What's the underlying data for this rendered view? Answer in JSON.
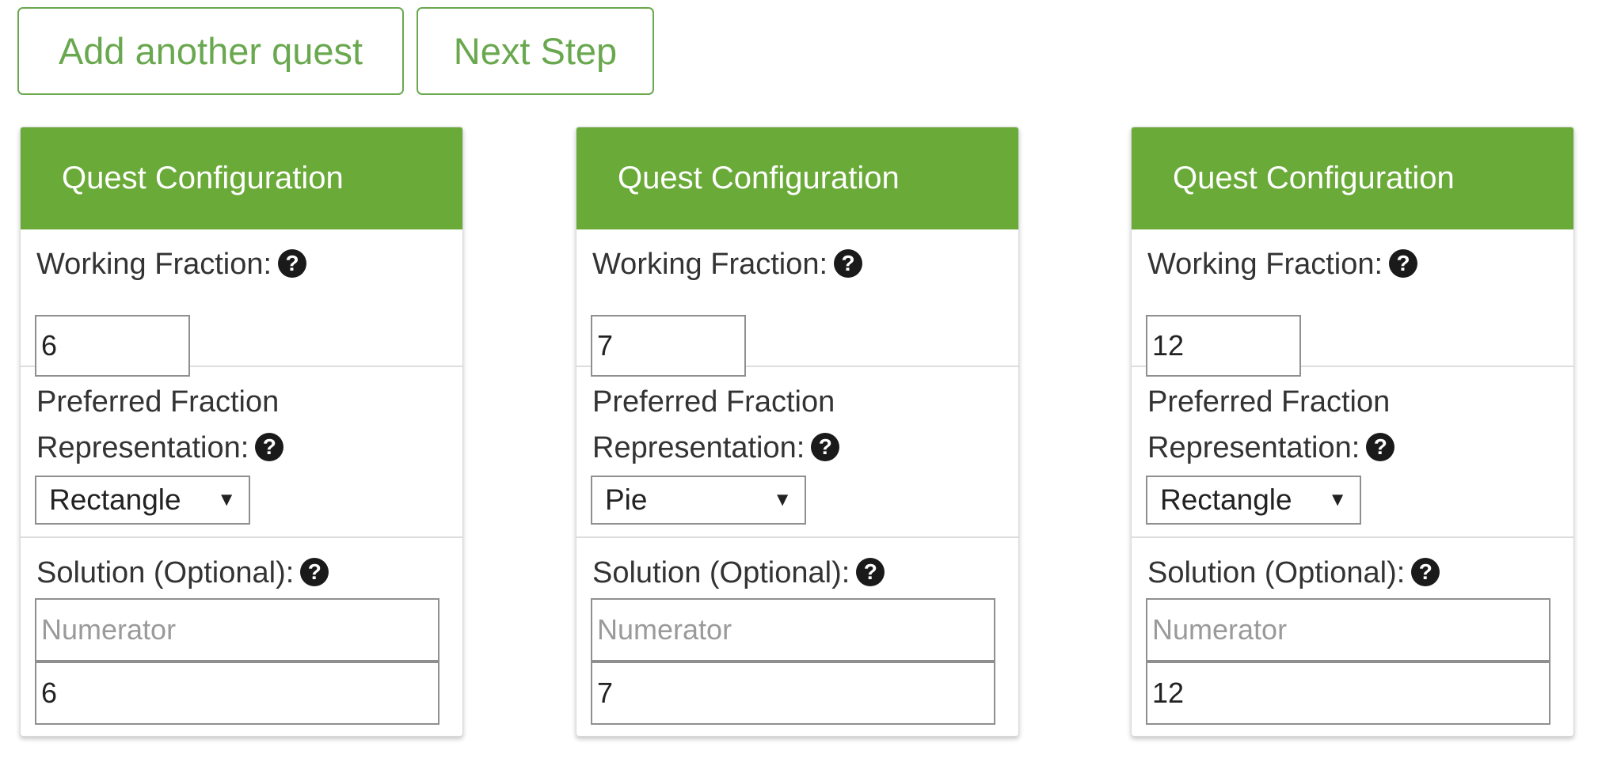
{
  "toolbar": {
    "add_label": "Add another quest",
    "next_label": "Next Step"
  },
  "labels": {
    "header": "Quest Configuration",
    "working_fraction": "Working Fraction:",
    "preferred_line1": "Preferred Fraction",
    "preferred_line2": "Representation:",
    "solution": "Solution (Optional):",
    "numerator_placeholder": "Numerator"
  },
  "icons": {
    "help": "question-circle-icon",
    "dropdown": "triangle-down-icon"
  },
  "colors": {
    "accent": "#6aa84f",
    "header_bg": "#6aaa38"
  },
  "panels": [
    {
      "working_fraction": "6",
      "representation": "Rectangle",
      "numerator": "",
      "denominator": "6"
    },
    {
      "working_fraction": "7",
      "representation": "Pie",
      "numerator": "",
      "denominator": "7"
    },
    {
      "working_fraction": "12",
      "representation": "Rectangle",
      "numerator": "",
      "denominator": "12"
    }
  ]
}
